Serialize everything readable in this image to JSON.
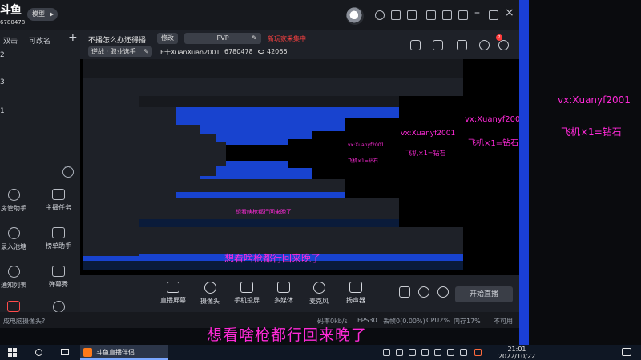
{
  "app": {
    "logo_text": "斗鱼",
    "logo_number": "6780478",
    "mode_label": "模型",
    "sidebar_tabs": [
      "双击",
      "可改名"
    ],
    "sidebar_lines": [
      "2",
      "3",
      "1"
    ],
    "sidebar_tools": [
      {
        "label": "房管助手",
        "icon": "user-shield-icon"
      },
      {
        "label": "主播任务",
        "icon": "task-check-icon"
      },
      {
        "label": "录入池塘",
        "icon": "download-icon"
      },
      {
        "label": "榜单助手",
        "icon": "rank-icon"
      },
      {
        "label": "通知列表",
        "icon": "download-icon"
      },
      {
        "label": "弹幕秀",
        "icon": "tv-icon"
      },
      {
        "label": "",
        "icon": "hot-icon"
      },
      {
        "label": "",
        "icon": "download-icon"
      }
    ]
  },
  "stream": {
    "room_title": "不播怎么办还得播",
    "edit_label": "修改",
    "mode": "PVP",
    "live_status": "新玩家采集中",
    "category": "逆战 · 职业选手",
    "streamer": "E十XuanXuan2001",
    "room_id": "6780478",
    "viewers": "42066"
  },
  "controls": [
    {
      "label": "直播屏幕",
      "icon": "monitor-icon"
    },
    {
      "label": "摄像头",
      "icon": "camera-icon"
    },
    {
      "label": "手机投屏",
      "icon": "phone-icon"
    },
    {
      "label": "多媒体",
      "icon": "media-icon"
    },
    {
      "label": "麦克风",
      "icon": "microphone-icon"
    },
    {
      "label": "扬声器",
      "icon": "speaker-icon"
    }
  ],
  "start_live_label": "开始直播",
  "status_bar": {
    "left_text": "成电脑摄像头?",
    "bitrate": "码率0kb/s",
    "fps": "FPS30",
    "drop": "丢帧0(0.00%)",
    "cpu": "CPU2%",
    "mem": "内存17%",
    "quality": "不可用"
  },
  "overlay": {
    "contact": "vx:Xuanyf2001",
    "gift": "飞机×1=钻石",
    "banner": "想看啥枪都行回来晚了"
  },
  "taskbar": {
    "app_label": "斗鱼直播伴侣",
    "time": "21:01",
    "date": "2022/10/22"
  }
}
